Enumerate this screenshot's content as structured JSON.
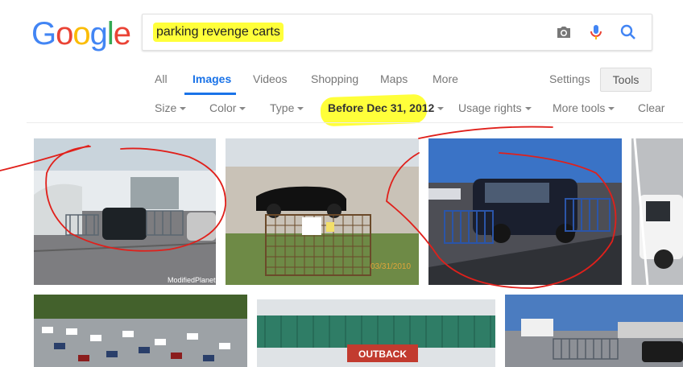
{
  "logo": {
    "letters": [
      "G",
      "o",
      "o",
      "g",
      "l",
      "e"
    ],
    "colors": [
      "#4285F4",
      "#EA4335",
      "#FBBC05",
      "#4285F4",
      "#34A853",
      "#EA4335"
    ]
  },
  "search": {
    "query": "parking revenge carts"
  },
  "tabs": [
    {
      "label": "All"
    },
    {
      "label": "Images"
    },
    {
      "label": "Videos"
    },
    {
      "label": "Shopping"
    },
    {
      "label": "Maps"
    },
    {
      "label": "More"
    }
  ],
  "settings_label": "Settings",
  "tools_label": "Tools",
  "filters": [
    {
      "label": "Size"
    },
    {
      "label": "Color"
    },
    {
      "label": "Type"
    },
    {
      "label": "Before Dec 31, 2012"
    },
    {
      "label": "Usage rights"
    },
    {
      "label": "More tools"
    },
    {
      "label": "Clear"
    }
  ],
  "images": {
    "img2_stamp": "03/31/2010",
    "img1_watermark": "ModifiedPlanet.com",
    "img6_sign": "OUTBACK"
  },
  "colors": {
    "accent": "#1a73e8",
    "highlight": "#ffff3a",
    "annotation": "#e0201b"
  }
}
